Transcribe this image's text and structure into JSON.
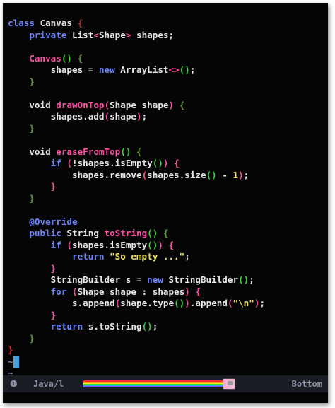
{
  "code": {
    "lines": [
      [
        {
          "t": "class ",
          "c": "kw"
        },
        {
          "t": "Canvas ",
          "c": "plain"
        },
        {
          "t": "{",
          "c": "b5"
        }
      ],
      [
        {
          "t": "    private ",
          "c": "kw"
        },
        {
          "t": "List",
          "c": "plain"
        },
        {
          "t": "<",
          "c": "b2"
        },
        {
          "t": "Shape",
          "c": "plain"
        },
        {
          "t": ">",
          "c": "b2"
        },
        {
          "t": " shapes;",
          "c": "plain"
        }
      ],
      [],
      [
        {
          "t": "    Canvas",
          "c": "fn"
        },
        {
          "t": "()",
          "c": "b3"
        },
        {
          "t": " ",
          "c": "plain"
        },
        {
          "t": "{",
          "c": "b4"
        }
      ],
      [
        {
          "t": "        shapes = ",
          "c": "plain"
        },
        {
          "t": "new ",
          "c": "kw"
        },
        {
          "t": "ArrayList",
          "c": "plain"
        },
        {
          "t": "<>",
          "c": "b2"
        },
        {
          "t": "()",
          "c": "b3"
        },
        {
          "t": ";",
          "c": "plain"
        }
      ],
      [
        {
          "t": "    }",
          "c": "b4"
        }
      ],
      [],
      [
        {
          "t": "    void ",
          "c": "plain"
        },
        {
          "t": "drawOnTop",
          "c": "fn"
        },
        {
          "t": "(",
          "c": "b2"
        },
        {
          "t": "Shape shape",
          "c": "plain"
        },
        {
          "t": ")",
          "c": "b2"
        },
        {
          "t": " ",
          "c": "plain"
        },
        {
          "t": "{",
          "c": "b4"
        }
      ],
      [
        {
          "t": "        shapes.add",
          "c": "plain"
        },
        {
          "t": "(",
          "c": "b2"
        },
        {
          "t": "shape",
          "c": "plain"
        },
        {
          "t": ")",
          "c": "b2"
        },
        {
          "t": ";",
          "c": "plain"
        }
      ],
      [
        {
          "t": "    }",
          "c": "b4"
        }
      ],
      [],
      [
        {
          "t": "    void ",
          "c": "plain"
        },
        {
          "t": "eraseFromTop",
          "c": "fn"
        },
        {
          "t": "()",
          "c": "b3"
        },
        {
          "t": " ",
          "c": "plain"
        },
        {
          "t": "{",
          "c": "b4"
        }
      ],
      [
        {
          "t": "        if ",
          "c": "kw"
        },
        {
          "t": "(",
          "c": "b2"
        },
        {
          "t": "!shapes.isEmpty",
          "c": "plain"
        },
        {
          "t": "()",
          "c": "b3"
        },
        {
          "t": ")",
          "c": "b2"
        },
        {
          "t": " ",
          "c": "plain"
        },
        {
          "t": "{",
          "c": "b2"
        }
      ],
      [
        {
          "t": "            shapes.remove",
          "c": "plain"
        },
        {
          "t": "(",
          "c": "b2"
        },
        {
          "t": "shapes.size",
          "c": "plain"
        },
        {
          "t": "()",
          "c": "b3"
        },
        {
          "t": " - ",
          "c": "plain"
        },
        {
          "t": "1",
          "c": "nm"
        },
        {
          "t": ")",
          "c": "b2"
        },
        {
          "t": ";",
          "c": "plain"
        }
      ],
      [
        {
          "t": "        }",
          "c": "b2"
        }
      ],
      [
        {
          "t": "    }",
          "c": "b4"
        }
      ],
      [],
      [
        {
          "t": "    @Override",
          "c": "an"
        }
      ],
      [
        {
          "t": "    public ",
          "c": "kw"
        },
        {
          "t": "String ",
          "c": "plain"
        },
        {
          "t": "toString",
          "c": "fn"
        },
        {
          "t": "()",
          "c": "b3"
        },
        {
          "t": " ",
          "c": "plain"
        },
        {
          "t": "{",
          "c": "b4"
        }
      ],
      [
        {
          "t": "        if ",
          "c": "kw"
        },
        {
          "t": "(",
          "c": "b2"
        },
        {
          "t": "shapes.isEmpty",
          "c": "plain"
        },
        {
          "t": "()",
          "c": "b3"
        },
        {
          "t": ")",
          "c": "b2"
        },
        {
          "t": " ",
          "c": "plain"
        },
        {
          "t": "{",
          "c": "b2"
        }
      ],
      [
        {
          "t": "            return ",
          "c": "kw"
        },
        {
          "t": "\"So empty ...\"",
          "c": "st"
        },
        {
          "t": ";",
          "c": "plain"
        }
      ],
      [
        {
          "t": "        }",
          "c": "b2"
        }
      ],
      [
        {
          "t": "        StringBuilder s = ",
          "c": "plain"
        },
        {
          "t": "new ",
          "c": "kw"
        },
        {
          "t": "StringBuilder",
          "c": "plain"
        },
        {
          "t": "()",
          "c": "b3"
        },
        {
          "t": ";",
          "c": "plain"
        }
      ],
      [
        {
          "t": "        for ",
          "c": "kw"
        },
        {
          "t": "(",
          "c": "b2"
        },
        {
          "t": "Shape shape : shapes",
          "c": "plain"
        },
        {
          "t": ")",
          "c": "b2"
        },
        {
          "t": " ",
          "c": "plain"
        },
        {
          "t": "{",
          "c": "b2"
        }
      ],
      [
        {
          "t": "            s.append",
          "c": "plain"
        },
        {
          "t": "(",
          "c": "b2"
        },
        {
          "t": "shape.type",
          "c": "plain"
        },
        {
          "t": "()",
          "c": "b3"
        },
        {
          "t": ")",
          "c": "b2"
        },
        {
          "t": ".append",
          "c": "plain"
        },
        {
          "t": "(",
          "c": "b2"
        },
        {
          "t": "\"\\n\"",
          "c": "st"
        },
        {
          "t": ")",
          "c": "b2"
        },
        {
          "t": ";",
          "c": "plain"
        }
      ],
      [
        {
          "t": "        }",
          "c": "b2"
        }
      ],
      [
        {
          "t": "        return ",
          "c": "kw"
        },
        {
          "t": "s.toString",
          "c": "plain"
        },
        {
          "t": "()",
          "c": "b3"
        },
        {
          "t": ";",
          "c": "plain"
        }
      ],
      [
        {
          "t": "    }",
          "c": "b4"
        }
      ],
      [
        {
          "t": "}",
          "c": "b5"
        }
      ]
    ],
    "empty_line_markers": [
      "~",
      "~"
    ]
  },
  "statusbar": {
    "mode_icon": "❶",
    "file_type": "Java/l",
    "position": "Bottom",
    "progress_icon": "nyan-cat-icon",
    "rainbow_colors": [
      "#ff3030",
      "#ff9a1a",
      "#ffe81a",
      "#3ddc3d",
      "#2aa7ff",
      "#7a4dff"
    ]
  }
}
